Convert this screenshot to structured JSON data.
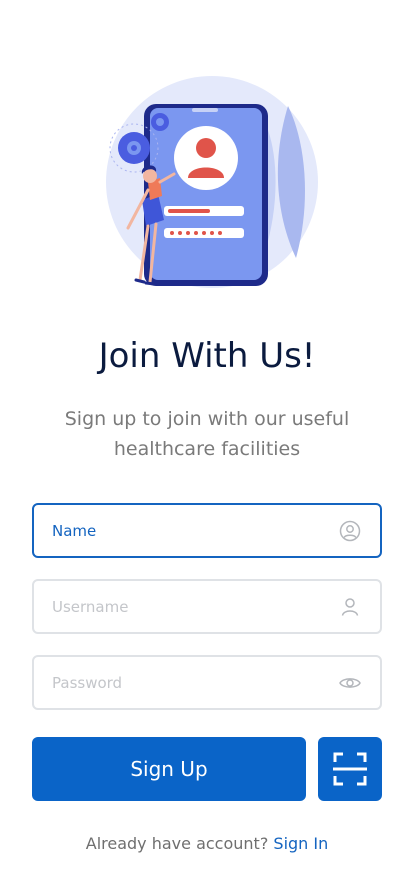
{
  "header": {
    "title": "Join With Us!",
    "subtitle": "Sign up to join with our useful healthcare facilities"
  },
  "form": {
    "name_placeholder": "Name",
    "username_placeholder": "Username",
    "password_placeholder": "Password",
    "name_icon": "user-circle-icon",
    "username_icon": "user-icon",
    "password_icon": "eye-icon"
  },
  "actions": {
    "signup_label": "Sign Up",
    "scan_icon": "scan-icon"
  },
  "footer": {
    "prompt": "Already have account?",
    "signin_label": "Sign In"
  },
  "colors": {
    "primary": "#0a64c8",
    "title": "#0b1b3f",
    "subtitle": "#7a7a7a",
    "field_border": "#dfe2e6",
    "placeholder": "#c4c6ca"
  }
}
